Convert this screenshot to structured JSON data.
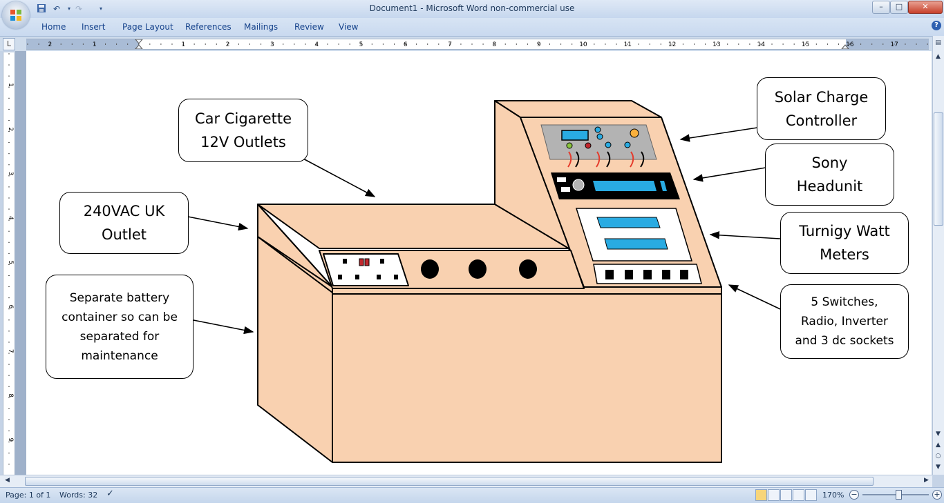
{
  "window": {
    "title": "Document1 - Microsoft Word non-commercial use",
    "minimize": "–",
    "maximize": "□",
    "close": "✕"
  },
  "ribbon": {
    "tabs": [
      "Home",
      "Insert",
      "Page Layout",
      "References",
      "Mailings",
      "Review",
      "View"
    ],
    "help": "?"
  },
  "ruler": {
    "numbers": [
      "2",
      "1",
      "1",
      "2",
      "3",
      "4",
      "5",
      "6",
      "7",
      "8",
      "9",
      "10",
      "11",
      "12",
      "13",
      "14",
      "15",
      "16",
      "17"
    ],
    "vnumbers": [
      "1",
      "2",
      "3",
      "4",
      "5",
      "6",
      "7",
      "8",
      "9",
      "10"
    ]
  },
  "callouts": {
    "car_cigarette": "Car Cigarette\n12V Outlets",
    "uk_outlet": "240VAC UK\nOutlet",
    "battery": "Separate battery\ncontainer so can be\nseparated for\nmaintenance",
    "solar": "Solar Charge\nController",
    "sony": "Sony\nHeadunit",
    "turnigy": "Turnigy Watt\nMeters",
    "switches": "5 Switches,\nRadio, Inverter\nand 3 dc sockets"
  },
  "status": {
    "page": "Page: 1 of 1",
    "words": "Words: 32",
    "zoom": "170%"
  },
  "colors": {
    "box_fill": "#f9d1b0",
    "panel_grey": "#b3b3b3",
    "display_blue": "#29abe2",
    "ribbon_blue": "#15428b"
  }
}
